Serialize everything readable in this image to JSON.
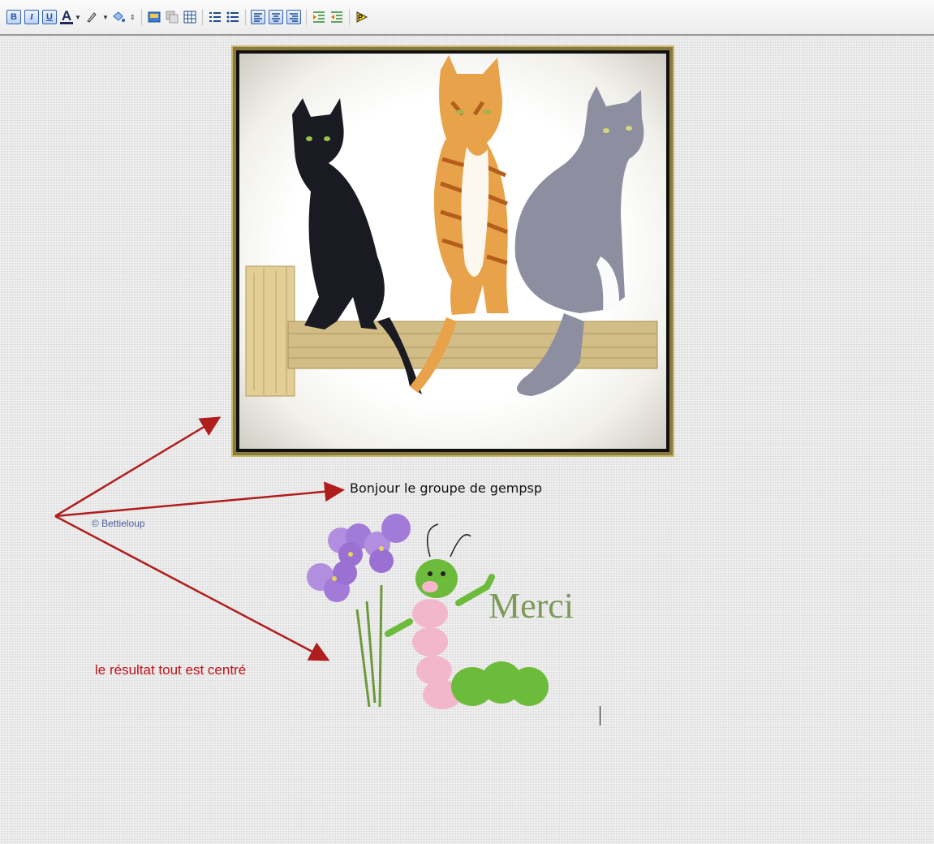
{
  "toolbar": {
    "buttons": [
      {
        "name": "bold-button",
        "glyph": "B"
      },
      {
        "name": "italic-button",
        "glyph": "I"
      },
      {
        "name": "underline-button",
        "glyph": "U"
      },
      {
        "name": "font-color-button",
        "glyph": "A"
      }
    ],
    "icons": [
      "bold-icon",
      "italic-icon",
      "underline-icon",
      "font-color-icon",
      "highlight-icon",
      "format-painter-icon",
      "insert-image-icon",
      "copy-icon",
      "insert-table-icon",
      "numbered-list-icon",
      "bullet-list-icon",
      "align-left-icon",
      "align-center-icon",
      "align-right-icon",
      "indent-icon",
      "outdent-icon",
      "p-tag-icon"
    ]
  },
  "content": {
    "greeting": "Bonjour le groupe de gempsp",
    "credit": "© Bettieloup",
    "result_note": "le résultat tout est centré",
    "merci_word": "Merci"
  },
  "colors": {
    "arrow": "#b01d1d",
    "frame_gold": "#8b7a3e",
    "toolbar_blue": "#2f62b4"
  }
}
